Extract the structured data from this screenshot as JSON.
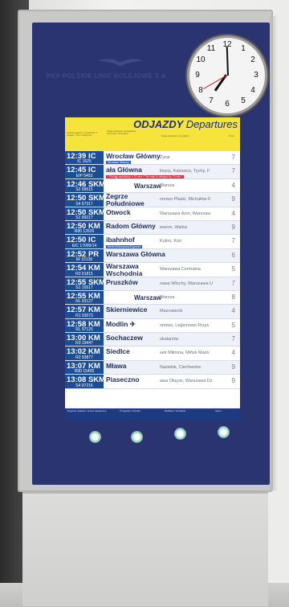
{
  "brand": {
    "name": "PKP POLSKIE LINIE KOLEJOWE S.A."
  },
  "clock": {
    "numbers": [
      "12",
      "1",
      "2",
      "3",
      "4",
      "5",
      "6",
      "7",
      "8",
      "9",
      "10",
      "11"
    ]
  },
  "board": {
    "title_pl": "ODJAZDY",
    "title_en": "Departures",
    "col1": "Godzina odjazdu / przewoźnik, nr pociągu / Time of departure",
    "col2": "Stacja docelowa / Szczegółowe informacje / Destination",
    "col3": "Stacja pośrednie / Via stations",
    "col4": "Peron"
  },
  "departures": [
    {
      "time": "12:39",
      "type": "IC",
      "train": "IC 1625",
      "dest": "Wrocław Główny",
      "via": "Żyrar",
      "platform": "7",
      "tag": "Wrocław Główny"
    },
    {
      "time": "12:45",
      "type": "IC",
      "train": "EIP 5403",
      "dest": "ała Główna",
      "via": "łówny, Katowice, Tychy, F",
      "platform": "7",
      "delay": "• Pociąg opóźniony o 10 min • The train is delayed by 10 min •"
    },
    {
      "time": "12:46",
      "type": "SKM",
      "train": "S2 99615",
      "center": "Warszaw",
      "via": "Warsza",
      "platform": "4"
    },
    {
      "time": "12:50",
      "type": "SKM",
      "train": "S4 97317",
      "dest": "Zegrze Południowe",
      "via": "onowo Płaski, Michałów-F",
      "platform": "9"
    },
    {
      "time": "12:50",
      "type": "SKM",
      "train": "S1 99217",
      "dest": "Otwock",
      "via": "Warszawa Anin, Warszaw",
      "platform": "4"
    },
    {
      "time": "12:50",
      "type": "KM",
      "train": "R80 12626",
      "dest": "Radom Główny",
      "via": "iewice, Warka",
      "platform": "9"
    },
    {
      "time": "12:50",
      "type": "IC",
      "train": "EIC 17009/14",
      "dest": "ibahnhof",
      "via": "Kutno, Kon",
      "platform": "7",
      "tag": "Berlin/Warszawa-Express"
    },
    {
      "time": "12:52",
      "type": "PR",
      "train": "IR 15136",
      "dest": "Warszawa Główna",
      "via": "",
      "platform": "6"
    },
    {
      "time": "12:54",
      "type": "KM",
      "train": "R3 91815",
      "dest": "Warszawa Wschodnia",
      "via": "Warszawa Centralna",
      "platform": "5"
    },
    {
      "time": "12:55",
      "type": "SKM",
      "train": "S1 10517",
      "dest": "Pruszków",
      "via": "zawa Włochy, Warszawa U",
      "platform": "7"
    },
    {
      "time": "12:55",
      "type": "KM",
      "train": "RL 93127",
      "center": "Warszaw",
      "via": "Warsza",
      "platform": "8"
    },
    {
      "time": "12:57",
      "type": "KM",
      "train": "R1 93073",
      "dest": "Skierniewice",
      "via": "Mazowiecki",
      "platform": "4"
    },
    {
      "time": "12:58",
      "type": "KM",
      "train": "RL 97125",
      "dest": "Modlin ✈",
      "via": "onowo, Legionowo Przys",
      "platform": "5"
    },
    {
      "time": "13:00",
      "type": "KM",
      "train": "R3 19447",
      "dest": "Sochaczew",
      "via": "okalanów",
      "platform": "7"
    },
    {
      "time": "13:02",
      "type": "KM",
      "train": "R2 93877",
      "dest": "Siedlce",
      "via": "sek Miłosna, Mińsk Mazo",
      "platform": "4"
    },
    {
      "time": "13:07",
      "type": "KM",
      "train": "R90 15405",
      "dest": "Mława",
      "via": "Nasielsk, Ciechanów",
      "platform": "9"
    },
    {
      "time": "13:08",
      "type": "SKM",
      "train": "S4 97216",
      "dest": "Piaseczno",
      "via": "awa Okęcie, Warszawa Dz",
      "platform": "9"
    }
  ],
  "footer": {
    "b1": "Wyjazdy ostatnie / recent departures",
    "b2": "Przyjazdy / Arrivals",
    "b3": "Rozkład / Timetable",
    "b4": "Menu"
  }
}
